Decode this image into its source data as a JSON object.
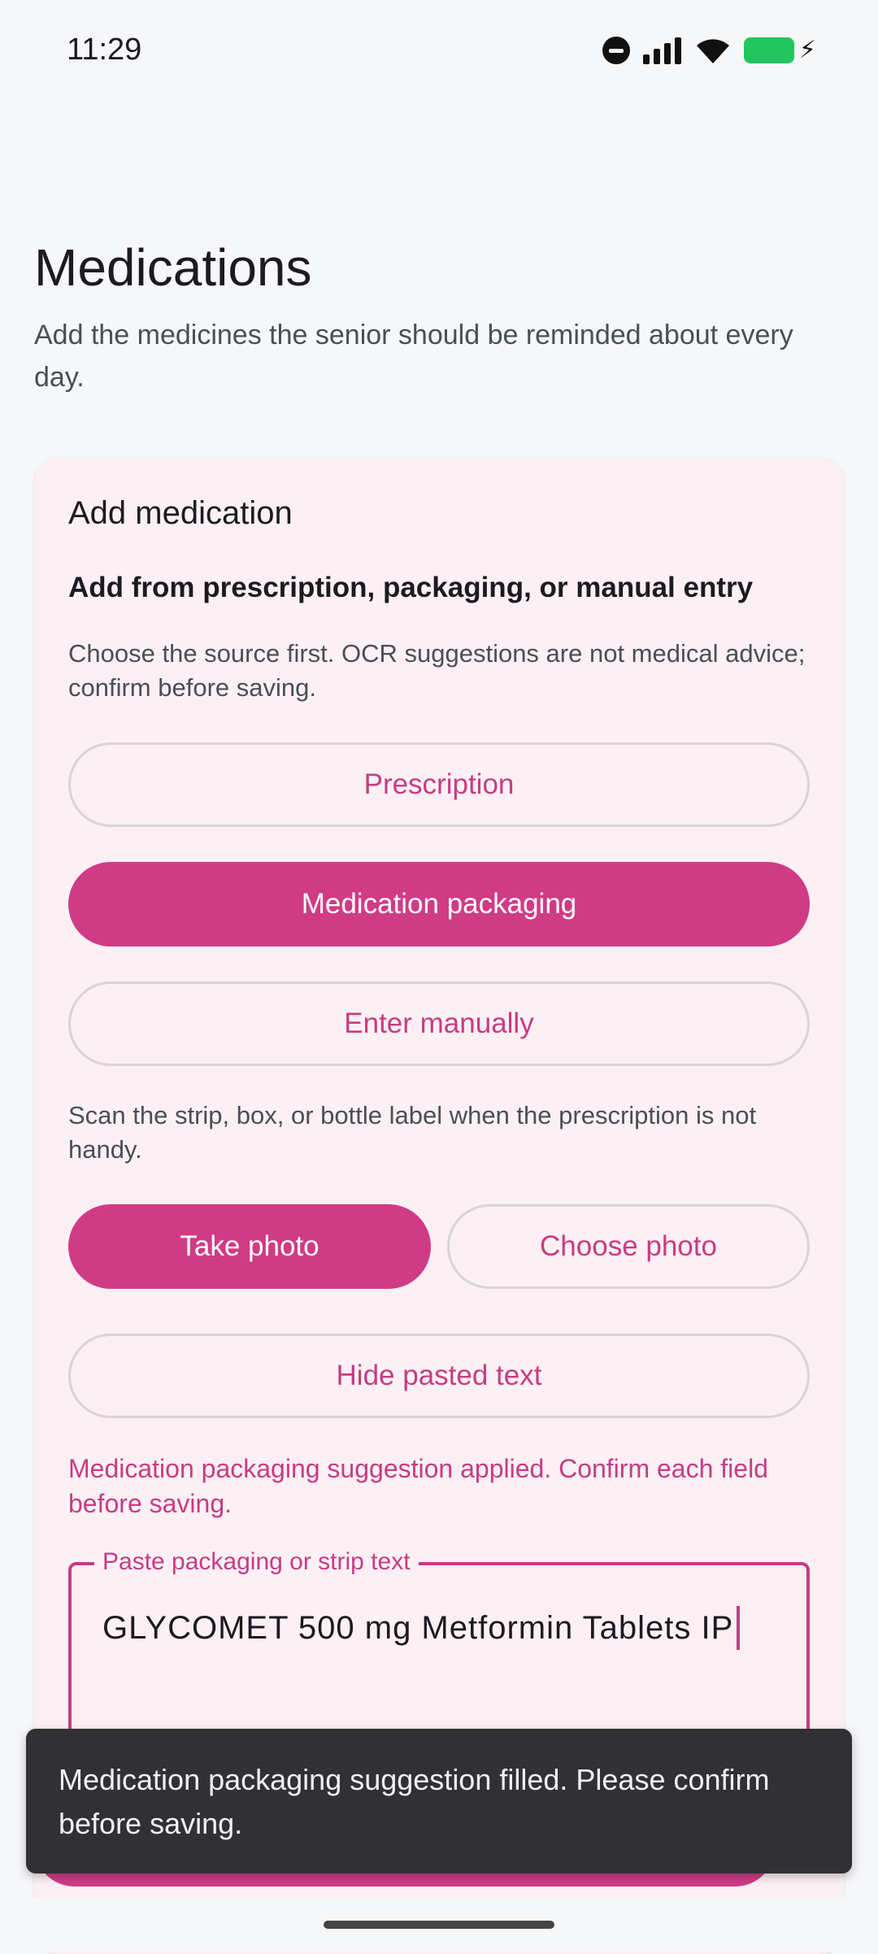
{
  "status_bar": {
    "time": "11:29"
  },
  "header": {
    "title": "Medications",
    "subtitle": "Add the medicines the senior should be reminded about every day."
  },
  "card": {
    "title": "Add medication",
    "heading": "Add from prescription, packaging, or manual entry",
    "help_text": "Choose the source first. OCR suggestions are not medical advice; confirm before saving.",
    "source_options": [
      {
        "label": "Prescription",
        "selected": false
      },
      {
        "label": "Medication packaging",
        "selected": true
      },
      {
        "label": "Enter manually",
        "selected": false
      }
    ],
    "scan_help": "Scan the strip, box, or bottle label when the prescription is not handy.",
    "take_photo_label": "Take photo",
    "choose_photo_label": "Choose photo",
    "hide_pasted_text_label": "Hide pasted text",
    "status_message": "Medication packaging suggestion applied. Confirm each field before saving.",
    "paste_field": {
      "label": "Paste packaging or strip text",
      "value": "GLYCOMET 500 mg Metformin Tablets IP"
    }
  },
  "snackbar": {
    "message": "Medication packaging suggestion filled. Please confirm before saving."
  },
  "colors": {
    "accent": "#d03b86",
    "accent_text": "#c73c83",
    "card_background": "#fcf0f5",
    "page_background": "#f6f7f9",
    "snackbar_background": "#313033"
  }
}
